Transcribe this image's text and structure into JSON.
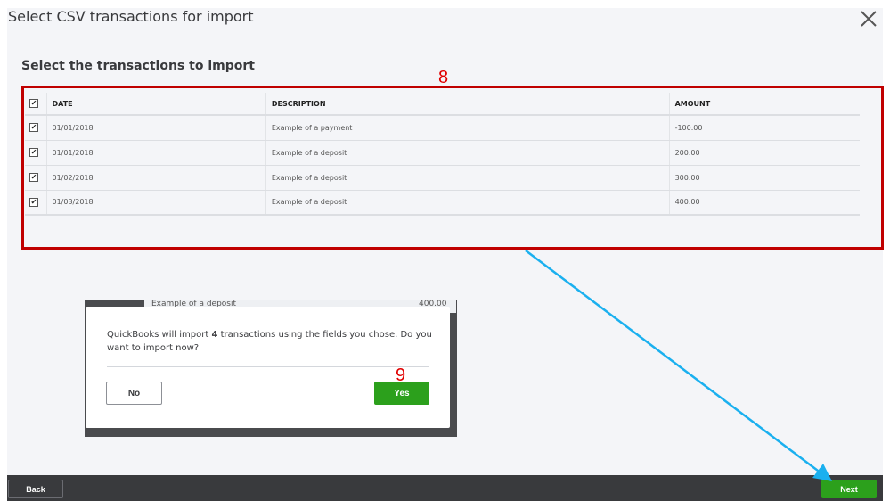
{
  "header": {
    "title": "Select CSV transactions for import",
    "close_icon": "close-icon"
  },
  "main": {
    "subtitle": "Select the transactions to import",
    "columns": [
      "DATE",
      "DESCRIPTION",
      "AMOUNT"
    ],
    "select_all_checked": true,
    "rows": [
      {
        "checked": true,
        "date": "01/01/2018",
        "description": "Example of a payment",
        "amount": "-100.00"
      },
      {
        "checked": true,
        "date": "01/01/2018",
        "description": "Example of a deposit",
        "amount": "200.00"
      },
      {
        "checked": true,
        "date": "01/02/2018",
        "description": "Example of a deposit",
        "amount": "300.00"
      },
      {
        "checked": true,
        "date": "01/03/2018",
        "description": "Example of a deposit",
        "amount": "400.00"
      }
    ]
  },
  "background_row": {
    "description": "Example of a deposit",
    "amount": "400.00"
  },
  "dialog": {
    "message_before": "QuickBooks will import ",
    "count": "4",
    "message_after": " transactions using the fields you chose. Do you want to import now?",
    "no_label": "No",
    "yes_label": "Yes"
  },
  "footer": {
    "back_label": "Back",
    "next_label": "Next"
  },
  "annotations": {
    "label_8": "8",
    "label_9": "9",
    "box_color": "#c00000",
    "arrow_color": "#1ab0ef"
  },
  "colors": {
    "accent_green": "#2ca01c",
    "footer_bg": "#393a3d",
    "page_bg": "#f4f5f8"
  }
}
